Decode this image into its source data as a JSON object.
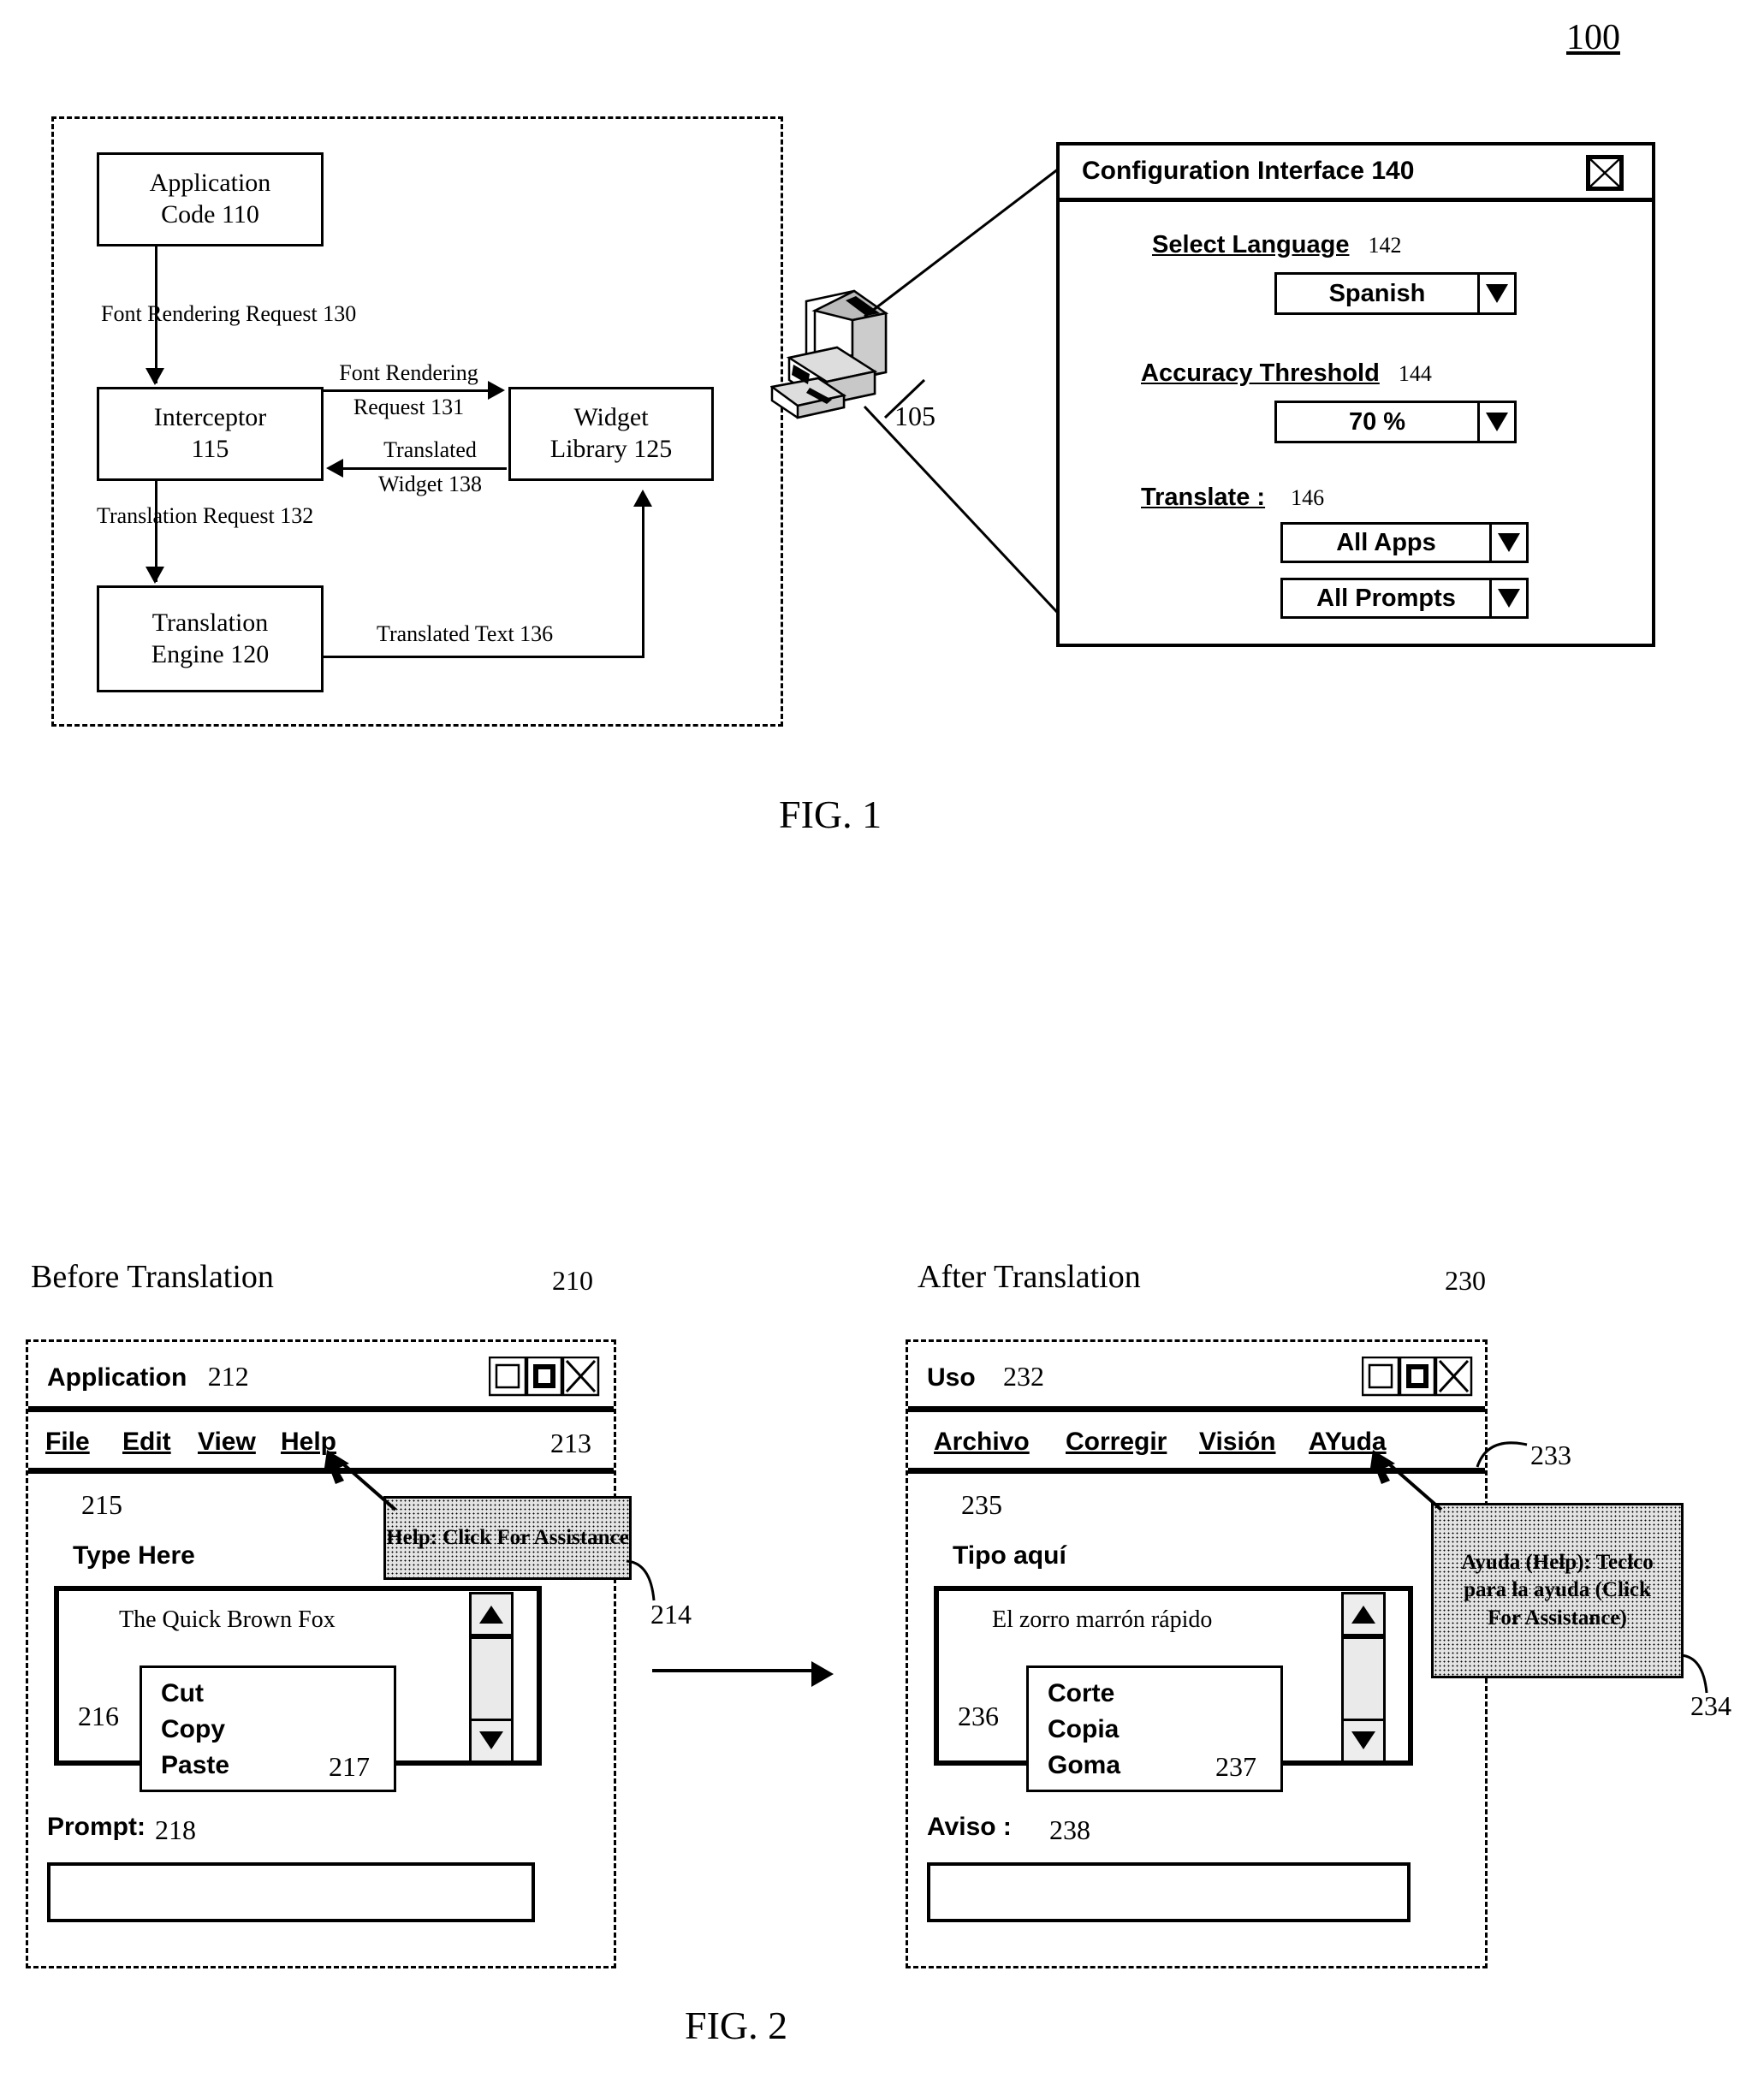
{
  "figure": {
    "top_ref": "100",
    "fig1_caption": "FIG. 1",
    "fig2_caption": "FIG. 2"
  },
  "fig1": {
    "system_ref": "105",
    "boxes": {
      "application_code": "Application\nCode 110",
      "application_code_line1": "Application",
      "application_code_line2": "Code 110",
      "interceptor_line1": "Interceptor",
      "interceptor_line2": "115",
      "widget_library_line1": "Widget",
      "widget_library_line2": "Library 125",
      "translation_engine_line1": "Translation",
      "translation_engine_line2": "Engine 120"
    },
    "arrows": {
      "font_rendering_request_130": "Font Rendering Request 130",
      "font_rendering_request_131_line1": "Font Rendering",
      "font_rendering_request_131_line2": "Request 131",
      "translated_widget_138_line1": "Translated",
      "translated_widget_138_line2": "Widget 138",
      "translation_request_132": "Translation Request 132",
      "translated_text_136": "Translated Text 136"
    },
    "computer_icon": "desktop-computer-icon"
  },
  "config_interface": {
    "title": "Configuration Interface 140",
    "close_icon": "close-icon",
    "fields": [
      {
        "label": "Select Language",
        "ref": "142",
        "value": "Spanish",
        "dropdown_icon": "chevron-down-icon"
      },
      {
        "label": "Accuracy Threshold",
        "ref": "144",
        "value": "70 %",
        "dropdown_icon": "chevron-down-icon"
      }
    ],
    "translate": {
      "label": "Translate :",
      "ref": "146",
      "options": [
        {
          "value": "All Apps",
          "dropdown_icon": "chevron-down-icon"
        },
        {
          "value": "All Prompts",
          "dropdown_icon": "chevron-down-icon"
        }
      ]
    }
  },
  "fig2": {
    "before": {
      "heading": "Before Translation",
      "ref": "210",
      "window_title": "Application",
      "window_title_ref": "212",
      "window_controls": [
        "minimize-icon",
        "maximize-icon",
        "close-icon"
      ],
      "menu_items": [
        "File",
        "Edit",
        "View",
        "Help"
      ],
      "menubar_ref": "213",
      "content_ref": "215",
      "label": "Type Here",
      "tooltip_text": "Help: Click For Assistance",
      "tooltip_ref": "214",
      "textarea_text": "The Quick Brown Fox",
      "textarea_ref": "216",
      "context_menu": [
        "Cut",
        "Copy",
        "Paste"
      ],
      "context_menu_ref": "217",
      "prompt_label": "Prompt:",
      "prompt_ref": "218",
      "prompt_value": "",
      "scroll_up_icon": "scroll-up-arrow-icon",
      "scroll_down_icon": "scroll-down-arrow-icon"
    },
    "after": {
      "heading": "After Translation",
      "ref": "230",
      "window_title": "Uso",
      "window_title_ref": "232",
      "window_controls": [
        "minimize-icon",
        "maximize-icon",
        "close-icon"
      ],
      "menu_items": [
        "Archivo",
        "Corregir",
        "Visión",
        "AYuda"
      ],
      "menubar_ref": "233",
      "content_ref": "235",
      "label": "Tipo aquí",
      "tooltip_text": "Ayuda (Help): Teclco para la ayuda (Click For Assistance)",
      "tooltip_ref": "234",
      "textarea_text": "El zorro marrón rápido",
      "textarea_ref": "236",
      "context_menu": [
        "Corte",
        "Copia",
        "Goma"
      ],
      "context_menu_ref": "237",
      "prompt_label": "Aviso :",
      "prompt_ref": "238",
      "prompt_value": "",
      "scroll_up_icon": "scroll-up-arrow-icon",
      "scroll_down_icon": "scroll-down-arrow-icon"
    }
  }
}
